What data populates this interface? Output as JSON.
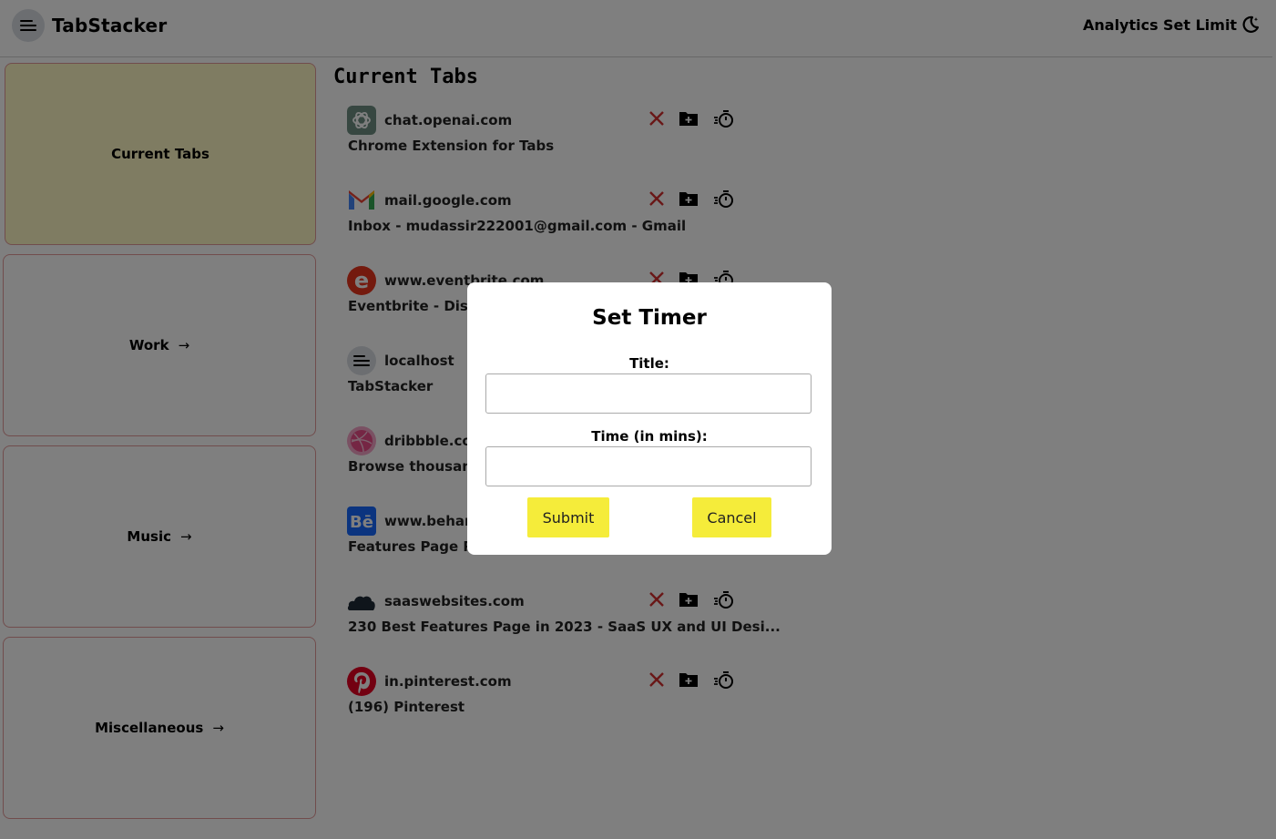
{
  "header": {
    "app_title": "TabStacker",
    "nav_analytics": "Analytics",
    "nav_set_limit": "Set Limit",
    "logo_icon": "stack-lines-icon",
    "theme_icon": "moon-star-icon"
  },
  "sidebar": {
    "items": [
      {
        "label": "Current Tabs",
        "arrow": ""
      },
      {
        "label": "Work",
        "arrow": "→"
      },
      {
        "label": "Music",
        "arrow": "→"
      },
      {
        "label": "Miscellaneous",
        "arrow": "→"
      }
    ]
  },
  "main": {
    "title": "Current Tabs",
    "tabs": [
      {
        "domain": "chat.openai.com",
        "title": "Chrome Extension for Tabs",
        "icon": "openai-icon"
      },
      {
        "domain": "mail.google.com",
        "title": "Inbox - mudassir222001@gmail.com - Gmail",
        "icon": "gmail-icon"
      },
      {
        "domain": "www.eventbrite.com",
        "title": "Eventbrite - Disco",
        "icon": "eventbrite-icon"
      },
      {
        "domain": "localhost",
        "title": "TabStacker",
        "icon": "stack-lines-icon"
      },
      {
        "domain": "dribbble.com",
        "title": "Browse thousands",
        "icon": "dribbble-icon"
      },
      {
        "domain": "www.behance",
        "title": "Features Page Pro",
        "icon": "behance-icon"
      },
      {
        "domain": "saaswebsites.com",
        "title": "230 Best Features Page in 2023 - SaaS UX and UI Desi...",
        "icon": "cloud-icon"
      },
      {
        "domain": "in.pinterest.com",
        "title": "(196) Pinterest",
        "icon": "pinterest-icon"
      }
    ],
    "action_icons": [
      "close-icon",
      "folder-add-icon",
      "timer-icon"
    ]
  },
  "modal": {
    "title": "Set Timer",
    "title_label": "Title:",
    "title_value": "",
    "time_label": "Time (in mins):",
    "time_value": "",
    "submit": "Submit",
    "cancel": "Cancel"
  },
  "colors": {
    "accent_yellow": "#f5ec3a",
    "active_category_bg": "#fff9c4",
    "card_border": "#e39a9a",
    "close_red": "#d32f2f",
    "overlay": "rgba(0,0,0,0.5)"
  }
}
